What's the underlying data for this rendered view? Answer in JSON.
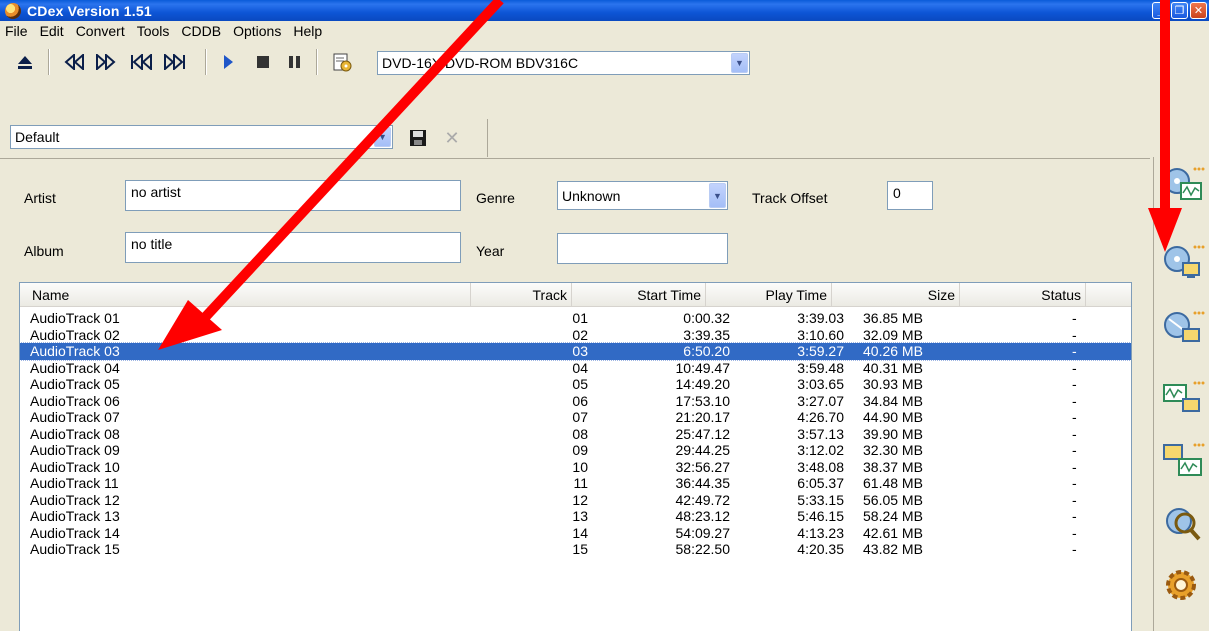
{
  "window": {
    "title": "CDex Version 1.51",
    "buttons": {
      "minimize": "_",
      "maximize": "❐",
      "close": "✕"
    }
  },
  "menu": [
    "File",
    "Edit",
    "Convert",
    "Tools",
    "CDDB",
    "Options",
    "Help"
  ],
  "toolbar": {
    "drive_selected": "DVD-16X DVD-ROM BDV316C",
    "profile_selected": "Default",
    "icons": [
      "eject-icon",
      "fast-rewind-icon",
      "fast-forward-icon",
      "previous-track-icon",
      "next-track-icon",
      "play-icon",
      "stop-icon",
      "pause-icon",
      "cd-info-icon",
      "save-icon",
      "delete-icon"
    ]
  },
  "form": {
    "artist_label": "Artist",
    "artist_value": "no artist",
    "genre_label": "Genre",
    "genre_value": "Unknown",
    "track_offset_label": "Track Offset",
    "track_offset_value": "0",
    "album_label": "Album",
    "album_value": "no title",
    "year_label": "Year",
    "year_value": ""
  },
  "table": {
    "columns": [
      "Name",
      "Track",
      "Start Time",
      "Play Time",
      "Size",
      "Status"
    ],
    "selected_index": 2,
    "rows": [
      {
        "name": "AudioTrack 01",
        "track": "01",
        "start": "0:00.32",
        "play": "3:39.03",
        "size": "36.85 MB",
        "status": "-"
      },
      {
        "name": "AudioTrack 02",
        "track": "02",
        "start": "3:39.35",
        "play": "3:10.60",
        "size": "32.09 MB",
        "status": "-"
      },
      {
        "name": "AudioTrack 03",
        "track": "03",
        "start": "6:50.20",
        "play": "3:59.27",
        "size": "40.26 MB",
        "status": "-"
      },
      {
        "name": "AudioTrack 04",
        "track": "04",
        "start": "10:49.47",
        "play": "3:59.48",
        "size": "40.31 MB",
        "status": "-"
      },
      {
        "name": "AudioTrack 05",
        "track": "05",
        "start": "14:49.20",
        "play": "3:03.65",
        "size": "30.93 MB",
        "status": "-"
      },
      {
        "name": "AudioTrack 06",
        "track": "06",
        "start": "17:53.10",
        "play": "3:27.07",
        "size": "34.84 MB",
        "status": "-"
      },
      {
        "name": "AudioTrack 07",
        "track": "07",
        "start": "21:20.17",
        "play": "4:26.70",
        "size": "44.90 MB",
        "status": "-"
      },
      {
        "name": "AudioTrack 08",
        "track": "08",
        "start": "25:47.12",
        "play": "3:57.13",
        "size": "39.90 MB",
        "status": "-"
      },
      {
        "name": "AudioTrack 09",
        "track": "09",
        "start": "29:44.25",
        "play": "3:12.02",
        "size": "32.30 MB",
        "status": "-"
      },
      {
        "name": "AudioTrack 10",
        "track": "10",
        "start": "32:56.27",
        "play": "3:48.08",
        "size": "38.37 MB",
        "status": "-"
      },
      {
        "name": "AudioTrack 11",
        "track": "11",
        "start": "36:44.35",
        "play": "6:05.37",
        "size": "61.48 MB",
        "status": "-"
      },
      {
        "name": "AudioTrack 12",
        "track": "12",
        "start": "42:49.72",
        "play": "5:33.15",
        "size": "56.05 MB",
        "status": "-"
      },
      {
        "name": "AudioTrack 13",
        "track": "13",
        "start": "48:23.12",
        "play": "5:46.15",
        "size": "58.24 MB",
        "status": "-"
      },
      {
        "name": "AudioTrack 14",
        "track": "14",
        "start": "54:09.27",
        "play": "4:13.23",
        "size": "42.61 MB",
        "status": "-"
      },
      {
        "name": "AudioTrack 15",
        "track": "15",
        "start": "58:22.50",
        "play": "4:20.35",
        "size": "43.82 MB",
        "status": "-"
      }
    ]
  },
  "sidebar": {
    "buttons": [
      "extract-cd-to-wav-icon",
      "extract-cd-to-mp3-icon",
      "extract-partial-track-icon",
      "convert-wav-to-mp3-icon",
      "convert-mp3-to-wav-icon",
      "cd-info-search-icon",
      "settings-gear-icon"
    ]
  },
  "annotations": {
    "arrow_color": "#ff0000"
  },
  "colors": {
    "selection": "#316ac5",
    "titlebar": "#0a5bd8"
  }
}
